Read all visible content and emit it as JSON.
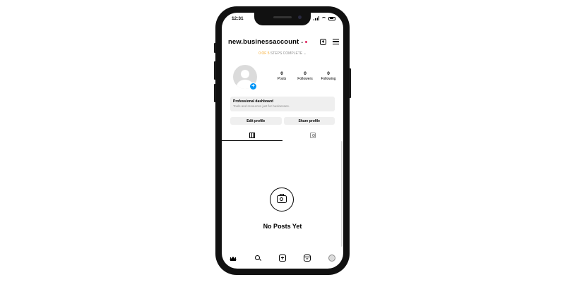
{
  "status_bar": {
    "time": "12:31"
  },
  "header": {
    "username": "new.businessaccount",
    "caret": "⌄"
  },
  "steps": {
    "progress": "0 OF 5",
    "label": "STEPS COMPLETE",
    "caret": "⌄"
  },
  "profile": {
    "add_badge": "+",
    "stats": [
      {
        "value": "0",
        "label": "Posts"
      },
      {
        "value": "0",
        "label": "Followers"
      },
      {
        "value": "0",
        "label": "Following"
      }
    ]
  },
  "dashboard": {
    "title": "Professional dashboard",
    "subtitle": "Tools and resources just for businesses."
  },
  "buttons": {
    "edit_profile": "Edit profile",
    "share_profile": "Share profile"
  },
  "empty_state": {
    "text": "No Posts Yet"
  },
  "colors": {
    "accent_blue": "#0095f6",
    "steps_orange": "#f5a623",
    "notification_red": "#e0245e"
  }
}
